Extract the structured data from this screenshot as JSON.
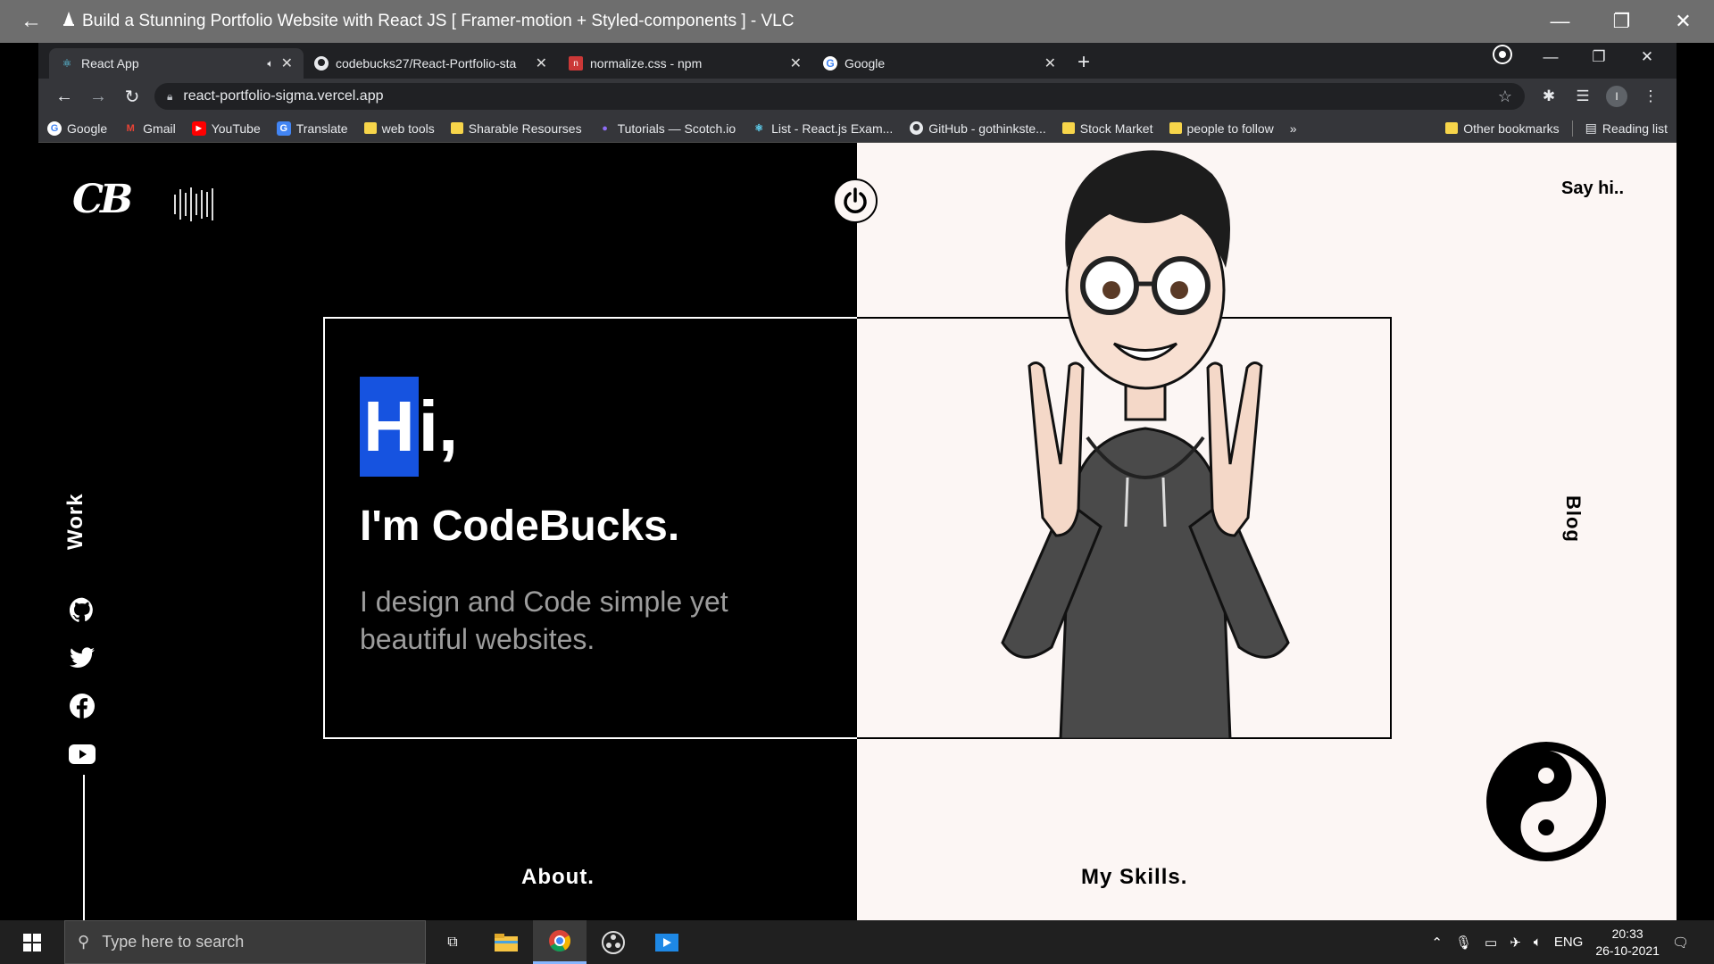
{
  "vlc": {
    "title": "Build a Stunning Portfolio Website with React JS  [ Framer-motion + Styled-components ] - VLC"
  },
  "browser": {
    "tabs": [
      {
        "title": "React App"
      },
      {
        "title": "codebucks27/React-Portfolio-sta"
      },
      {
        "title": "normalize.css - npm"
      },
      {
        "title": "Google"
      }
    ],
    "url": "react-portfolio-sigma.vercel.app",
    "bookmarks": [
      {
        "label": "Google"
      },
      {
        "label": "Gmail"
      },
      {
        "label": "YouTube"
      },
      {
        "label": "Translate"
      },
      {
        "label": "web tools"
      },
      {
        "label": "Sharable Resourses"
      },
      {
        "label": "Tutorials — Scotch.io"
      },
      {
        "label": "List - React.js Exam..."
      },
      {
        "label": "GitHub - gothinkste..."
      },
      {
        "label": "Stock Market"
      },
      {
        "label": "people to follow"
      }
    ],
    "bookmarks_more": "»",
    "other_bookmarks": "Other bookmarks",
    "reading_list": "Reading list"
  },
  "site": {
    "logo": "CB",
    "say_hi": "Say hi..",
    "blog": "Blog",
    "work": "Work",
    "about": "About.",
    "skills": "My Skills.",
    "hero": {
      "hi_h": "H",
      "hi_rest": "i,",
      "name": "I'm CodeBucks.",
      "tagline": "I design and Code simple yet beautiful websites."
    },
    "socials": [
      "github-icon",
      "twitter-icon",
      "facebook-icon",
      "youtube-icon"
    ]
  },
  "taskbar": {
    "search_placeholder": "Type here to search",
    "lang": "ENG",
    "time": "20:33",
    "date": "26-10-2021"
  }
}
